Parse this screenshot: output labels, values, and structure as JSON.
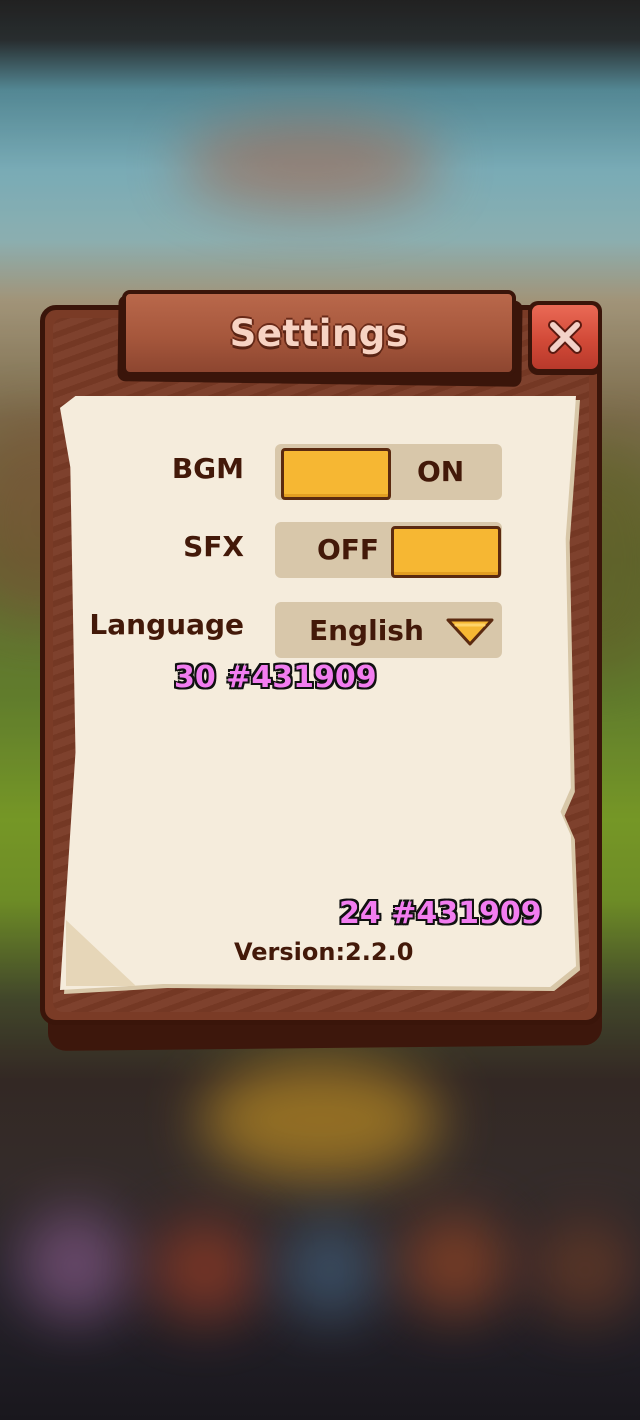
{
  "dialog": {
    "title": "Settings",
    "close_icon": "close-x-icon"
  },
  "settings": {
    "bgm": {
      "label": "BGM",
      "state": "ON",
      "enabled": true
    },
    "sfx": {
      "label": "SFX",
      "state": "OFF",
      "enabled": false
    },
    "language": {
      "label": "Language",
      "value": "English",
      "icon": "chevron-down-icon"
    }
  },
  "debug_labels": {
    "top": "30 #431909",
    "bottom": "24 #431909"
  },
  "footer": {
    "version": "Version:2.2.0"
  },
  "colors": {
    "text": "#431909",
    "toggle_knob": "#f6b733",
    "toggle_track": "#d8c7aa",
    "paper": "#f5ecdc",
    "wood": "#7a3b26",
    "close_button": "#d24a38",
    "debug_text": "#f27df0"
  }
}
